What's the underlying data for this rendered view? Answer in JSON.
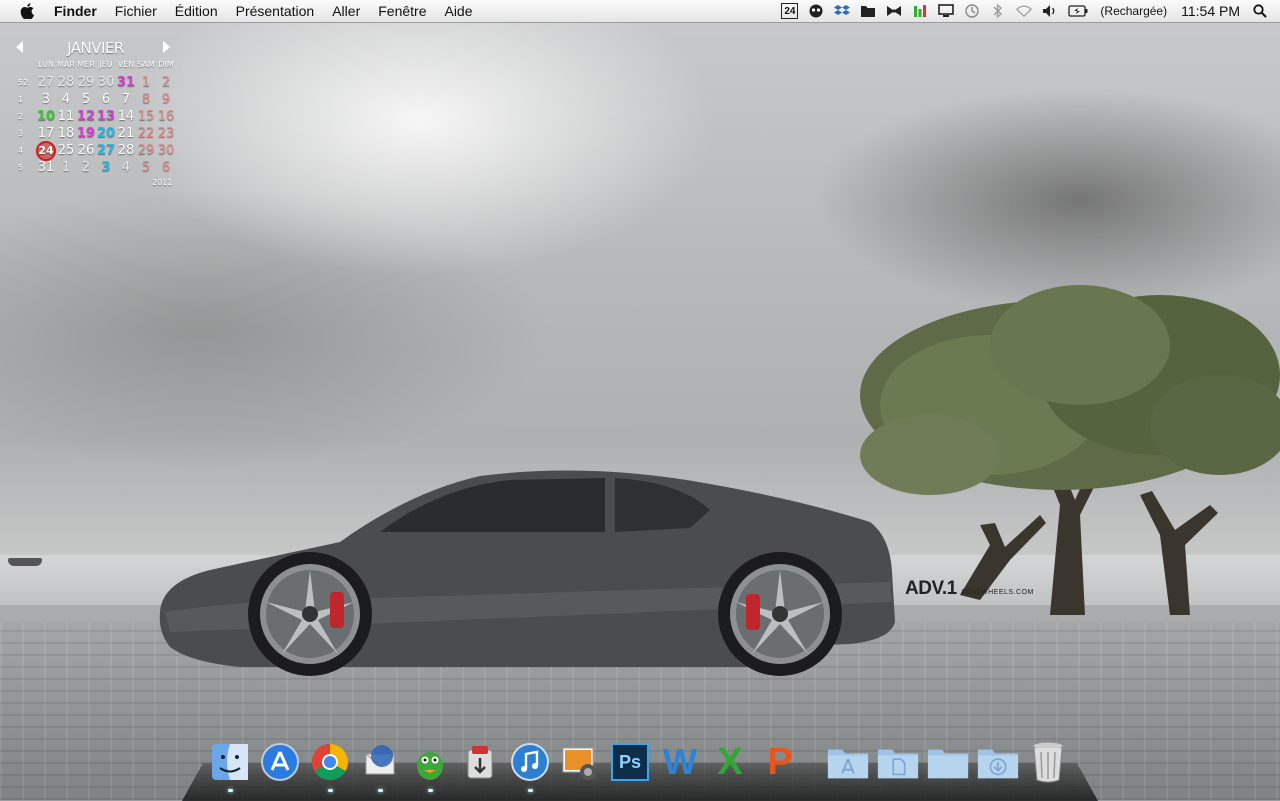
{
  "menubar": {
    "app": "Finder",
    "menus": [
      "Fichier",
      "Édition",
      "Présentation",
      "Aller",
      "Fenêtre",
      "Aide"
    ],
    "status": {
      "calendar_badge": "24",
      "battery_text": "(Rechargée)",
      "clock": "11:54 PM"
    }
  },
  "calendar": {
    "month": "JANVIER",
    "year": "2011",
    "weekdays": [
      "LUN",
      "MAR",
      "MER",
      "JEU",
      "VEN",
      "SAM",
      "DIM"
    ],
    "weeks": [
      {
        "wk": "52",
        "days": [
          "27",
          "28",
          "29",
          "30",
          "31",
          "1",
          "2"
        ]
      },
      {
        "wk": "1",
        "days": [
          "3",
          "4",
          "5",
          "6",
          "7",
          "8",
          "9"
        ]
      },
      {
        "wk": "2",
        "days": [
          "10",
          "11",
          "12",
          "13",
          "14",
          "15",
          "16"
        ]
      },
      {
        "wk": "3",
        "days": [
          "17",
          "18",
          "19",
          "20",
          "21",
          "22",
          "23"
        ]
      },
      {
        "wk": "4",
        "days": [
          "24",
          "25",
          "26",
          "27",
          "28",
          "29",
          "30"
        ]
      },
      {
        "wk": "5",
        "days": [
          "31",
          "1",
          "2",
          "3",
          "4",
          "5",
          "6"
        ]
      }
    ],
    "today": "24",
    "colors": {
      "green": "#3ec33e",
      "purple": "#d23fd0",
      "cyan": "#2fb3e0",
      "today_ring": "#d61c1c"
    }
  },
  "wallpaper": {
    "logo": "ADV.1",
    "url": "ADV1WHEELS.COM"
  },
  "dock": {
    "apps": [
      {
        "name": "Finder",
        "icon": "finder-icon"
      },
      {
        "name": "App Store",
        "icon": "app-store-icon"
      },
      {
        "name": "Google Chrome",
        "icon": "chrome-icon"
      },
      {
        "name": "Thunderbird",
        "icon": "thunderbird-icon"
      },
      {
        "name": "Adium",
        "icon": "adium-icon"
      },
      {
        "name": "Transmission",
        "icon": "transmission-icon"
      },
      {
        "name": "iTunes",
        "icon": "itunes-icon"
      },
      {
        "name": "iPhoto",
        "icon": "iphoto-icon"
      },
      {
        "name": "Photoshop",
        "icon": "photoshop-icon",
        "label": "Ps"
      },
      {
        "name": "Word",
        "icon": "word-icon",
        "label": "W"
      },
      {
        "name": "Excel",
        "icon": "excel-icon",
        "label": "X"
      },
      {
        "name": "PowerPoint",
        "icon": "powerpoint-icon",
        "label": "P"
      }
    ],
    "stacks": [
      {
        "name": "Applications",
        "icon": "applications-folder-icon"
      },
      {
        "name": "Documents",
        "icon": "documents-folder-icon"
      },
      {
        "name": "Folder",
        "icon": "folder-icon"
      },
      {
        "name": "Downloads",
        "icon": "downloads-folder-icon"
      },
      {
        "name": "Trash",
        "icon": "trash-icon"
      }
    ]
  }
}
